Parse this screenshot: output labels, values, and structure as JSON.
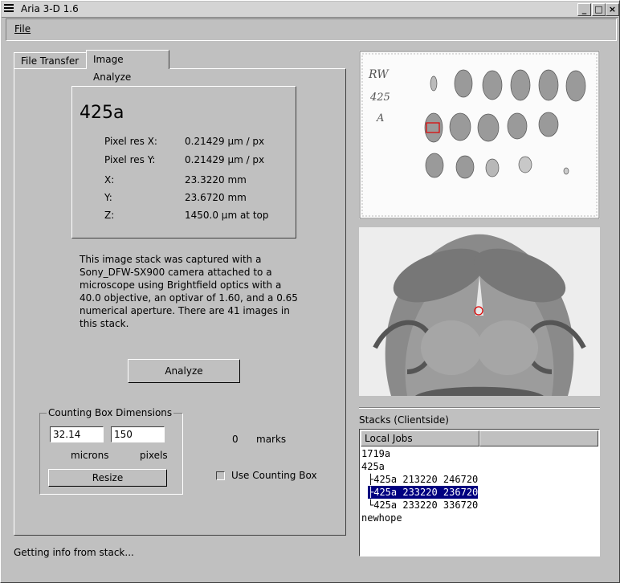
{
  "window": {
    "title": "Aria 3-D 1.6",
    "btn_minimize": "_",
    "btn_maximize": "□",
    "btn_close": "×"
  },
  "menu": {
    "file": "File"
  },
  "tabs": [
    {
      "label": "File Transfer",
      "active": false
    },
    {
      "label": "Image Analyze",
      "active": true
    }
  ],
  "info": {
    "name": "425a",
    "pixel_res_x_label": "Pixel res X:",
    "pixel_res_x": "0.21429 µm / px",
    "pixel_res_y_label": "Pixel res Y:",
    "pixel_res_y": "0.21429 µm / px",
    "x_label": "X:",
    "x": "23.3220 mm",
    "y_label": "Y:",
    "y": "23.6720 mm",
    "z_label": "Z:",
    "z": "1450.0 µm at top"
  },
  "description": "This image stack was captured with a Sony_DFW-SX900 camera attached to a microscope using Brightfield optics with a 40.0 objective, an optivar of 1.60, and a 0.65 numerical aperture. There are 41 images in this stack.",
  "analyze_button": "Analyze",
  "counting_box": {
    "legend": "Counting Box Dimensions",
    "microns_value": "32.14",
    "pixels_value": "150",
    "microns_label": "microns",
    "pixels_label": "pixels",
    "resize_button": "Resize"
  },
  "marks": {
    "count": "0",
    "label": "marks"
  },
  "use_counting_box": {
    "label": "Use Counting Box",
    "checked": false
  },
  "slide_label": {
    "line1": "RW",
    "line2": "425",
    "line3": "A"
  },
  "stacks": {
    "title": "Stacks (Clientside)",
    "column": "Local Jobs",
    "rows": [
      {
        "text": "1719a",
        "selected": false
      },
      {
        "text": "425a",
        "selected": false
      },
      {
        "text": "├425a 213220 246720",
        "selected": false
      },
      {
        "text": "├425a 233220 236720",
        "selected": true
      },
      {
        "text": "└425a 233220 336720",
        "selected": false
      },
      {
        "text": "newhope",
        "selected": false
      }
    ]
  },
  "status": "Getting info from stack..."
}
